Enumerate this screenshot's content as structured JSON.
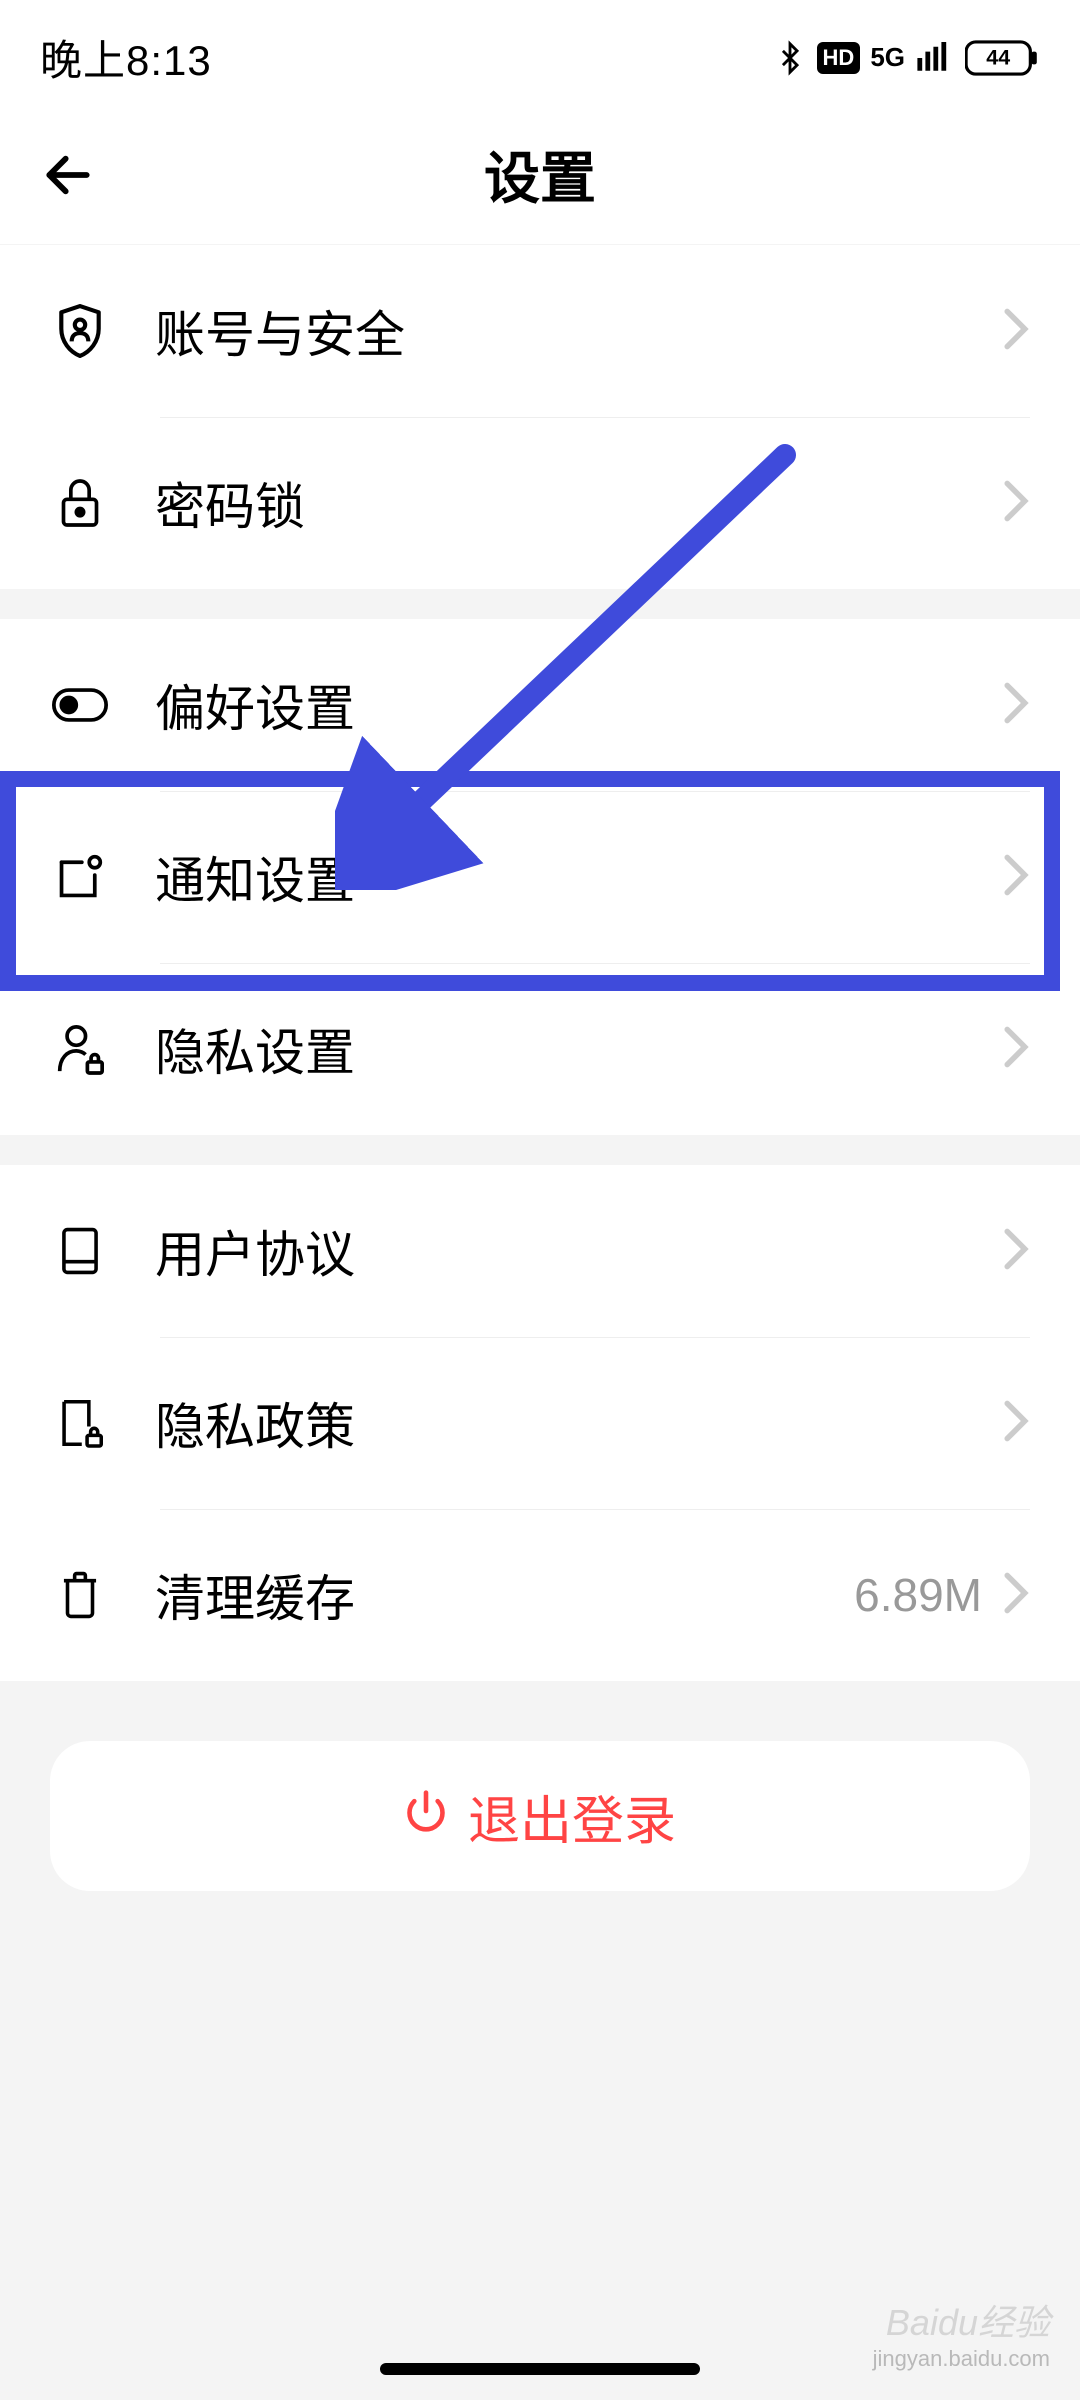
{
  "status_bar": {
    "time": "晚上8:13",
    "network_type": "5G",
    "hd_badge": "HD",
    "battery": "44"
  },
  "header": {
    "title": "设置"
  },
  "groups": [
    {
      "items": [
        {
          "label": "账号与安全",
          "icon": "shield-person",
          "value": ""
        },
        {
          "label": "密码锁",
          "icon": "lock",
          "value": ""
        }
      ]
    },
    {
      "items": [
        {
          "label": "偏好设置",
          "icon": "toggle",
          "value": ""
        },
        {
          "label": "通知设置",
          "icon": "notification-box",
          "value": ""
        },
        {
          "label": "隐私设置",
          "icon": "user-lock",
          "value": ""
        }
      ]
    },
    {
      "items": [
        {
          "label": "用户协议",
          "icon": "document",
          "value": ""
        },
        {
          "label": "隐私政策",
          "icon": "doc-lock",
          "value": ""
        },
        {
          "label": "清理缓存",
          "icon": "trash",
          "value": "6.89M"
        }
      ]
    }
  ],
  "logout": {
    "label": "退出登录"
  },
  "watermark": {
    "brand": "Baidu经验",
    "domain": "jingyan.baidu.com"
  },
  "annotation": {
    "highlight_color": "#3f4bdb"
  }
}
